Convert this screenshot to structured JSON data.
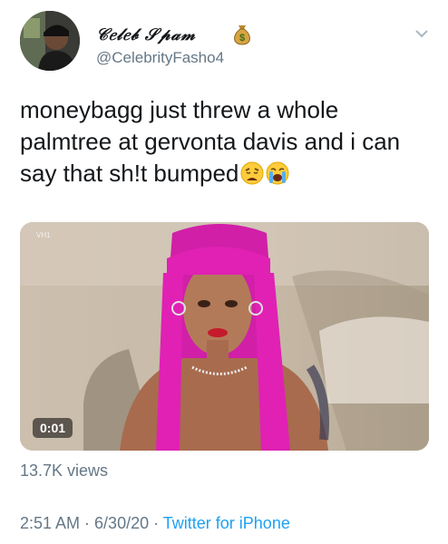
{
  "tweet": {
    "author_name": "𝒞𝑒𝓁𝑒𝒷 𝒮𝓅𝒶𝓂",
    "author_handle": "@CelebrityFasho4",
    "author_emoji_icon": "money-bag-icon",
    "text_line1": "moneybagg just threw a whole",
    "text_line2": "palmtree at gervonta davis and i can",
    "text_line3": "say that shǃt bumped",
    "text_emojis": [
      "weary-face-icon",
      "crying-face-icon"
    ],
    "media": {
      "watermark": "VH1",
      "timer": "0:01"
    },
    "views": "13.7K views",
    "time": "2:51 AM",
    "separator": " · ",
    "date": "6/30/20",
    "source": "Twitter for iPhone",
    "colors": {
      "secondary_text": "#657786",
      "link": "#1da1f2",
      "text": "#14171a",
      "hair_accent": "#d11fa8"
    }
  }
}
